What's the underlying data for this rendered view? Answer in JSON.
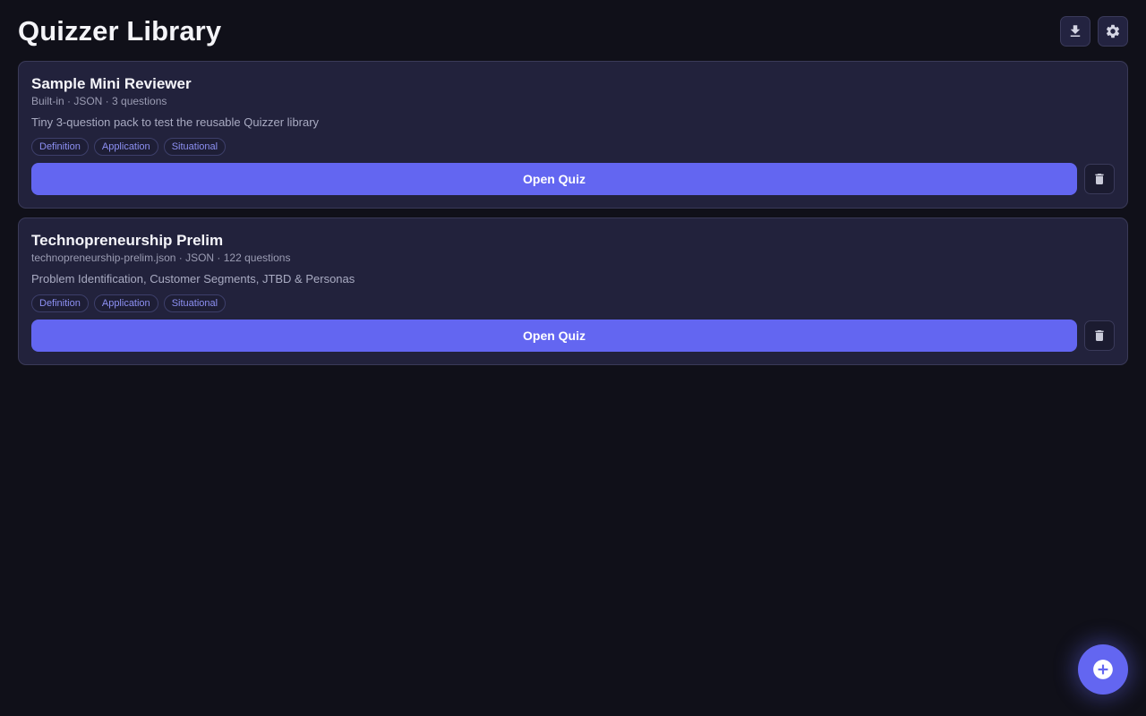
{
  "header": {
    "title": "Quizzer Library",
    "actions": [
      {
        "icon": "download-icon"
      },
      {
        "icon": "gear-icon"
      }
    ]
  },
  "quizzes": [
    {
      "title": "Sample Mini Reviewer",
      "meta": "Built-in · JSON · 3 questions",
      "description": "Tiny 3-question pack to test the reusable Quizzer library",
      "tags": [
        "Definition",
        "Application",
        "Situational"
      ],
      "open_label": "Open Quiz"
    },
    {
      "title": "Technopreneurship Prelim",
      "meta": "technopreneurship-prelim.json · JSON · 122 questions",
      "description": "Problem Identification, Customer Segments, JTBD & Personas",
      "tags": [
        "Definition",
        "Application",
        "Situational"
      ],
      "open_label": "Open Quiz"
    }
  ],
  "fab": {
    "icon": "add-circle-icon"
  },
  "colors": {
    "background": "#101019",
    "card": "#22223c",
    "accent": "#6366f1",
    "tag_text": "#8d90f3"
  }
}
